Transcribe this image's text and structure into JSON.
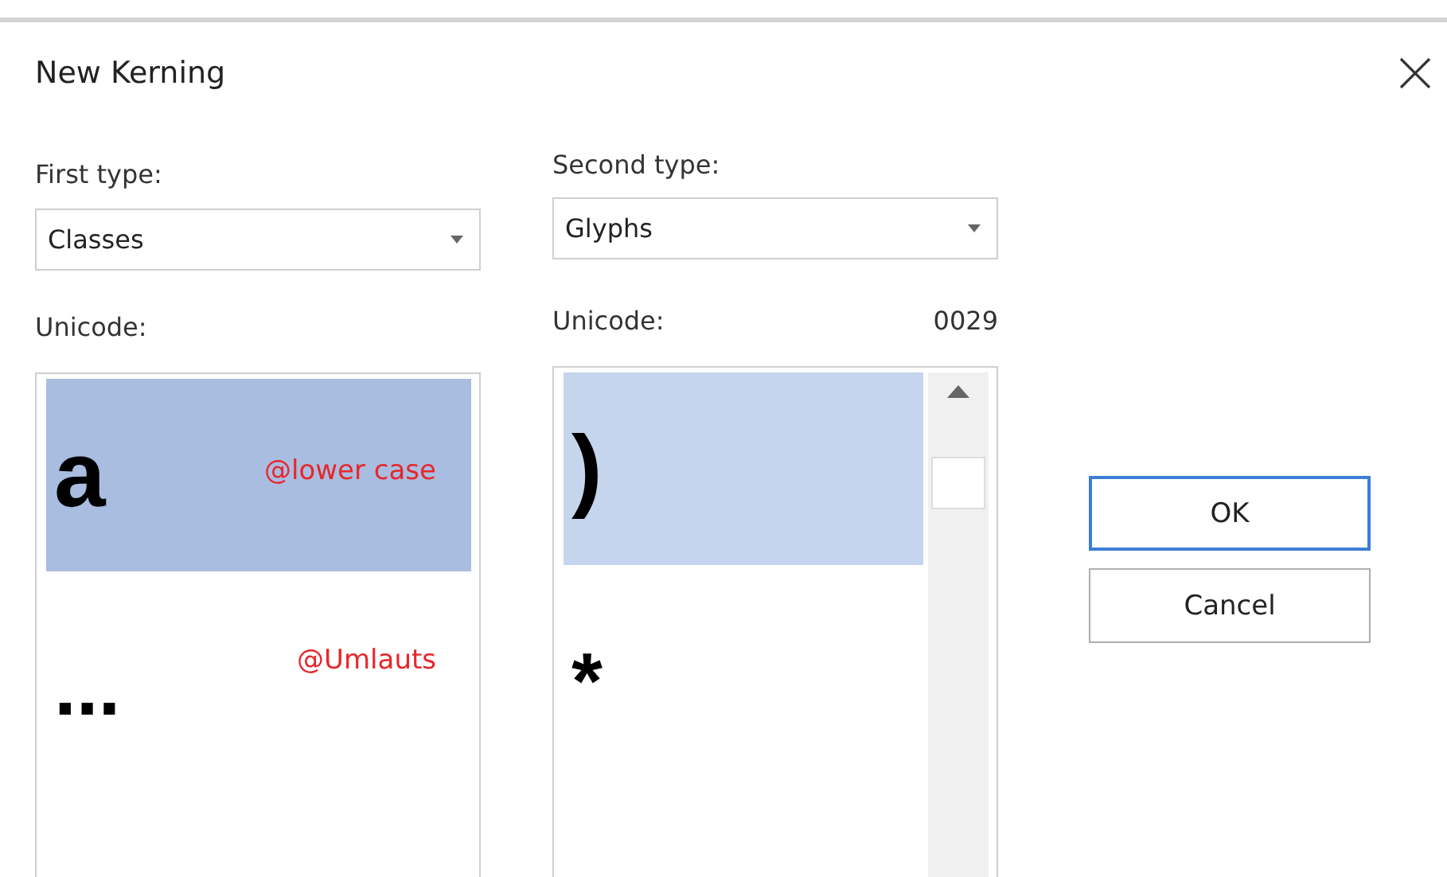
{
  "window": {
    "title": "New Kerning"
  },
  "first": {
    "label": "First type:",
    "value": "Classes",
    "unicode_label": "Unicode:",
    "items": [
      {
        "glyph": "a",
        "name": "@lower case",
        "selected": true
      },
      {
        "glyph": "...",
        "name": "@Umlauts",
        "selected": false
      }
    ]
  },
  "second": {
    "label": "Second type:",
    "value": "Glyphs",
    "unicode_label": "Unicode:",
    "unicode_value": "0029",
    "items": [
      {
        "glyph": ")",
        "selected": true
      },
      {
        "glyph": "*",
        "selected": false
      }
    ]
  },
  "buttons": [
    {
      "label": "OK",
      "default": true
    },
    {
      "label": "Cancel",
      "default": false
    }
  ]
}
